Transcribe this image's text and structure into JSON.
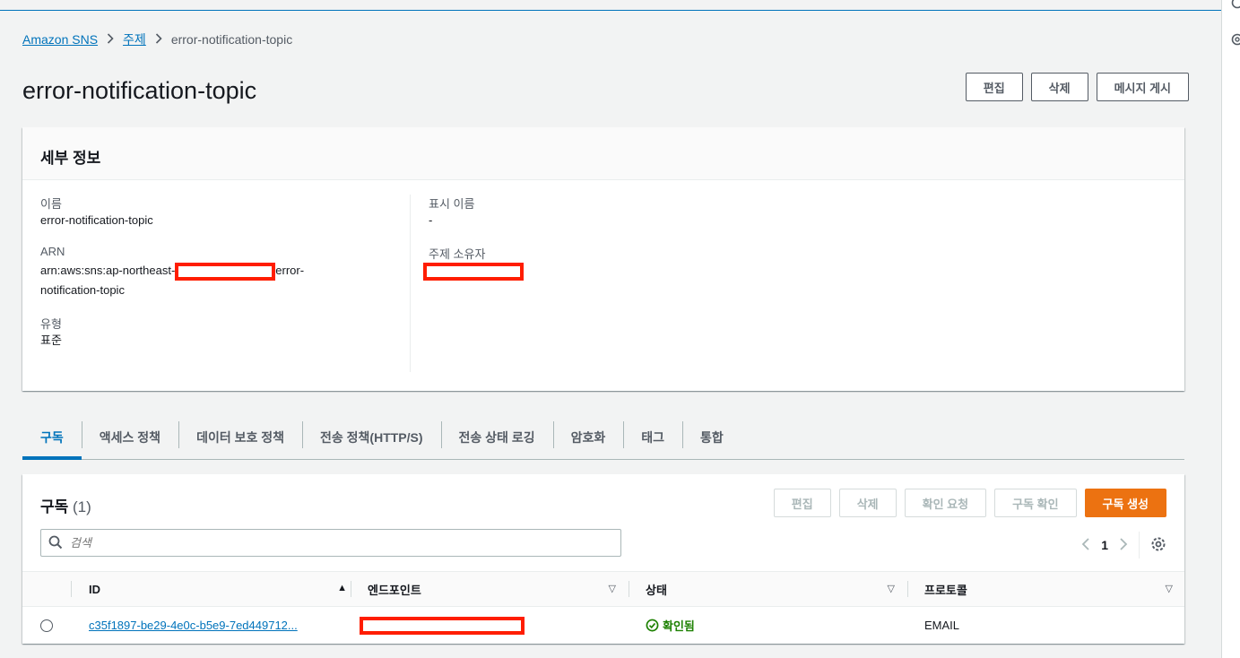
{
  "breadcrumb": {
    "root": "Amazon SNS",
    "section": "주제",
    "current": "error-notification-topic"
  },
  "page": {
    "title": "error-notification-topic"
  },
  "header_buttons": {
    "edit": "편집",
    "delete": "삭제",
    "publish": "메시지 게시"
  },
  "details": {
    "heading": "세부 정보",
    "name_label": "이름",
    "name_value": "error-notification-topic",
    "arn_label": "ARN",
    "arn_prefix": "arn:aws:sns:ap-northeast-",
    "arn_suffix_line1": "error-",
    "arn_suffix_line2": "notification-topic",
    "type_label": "유형",
    "type_value": "표준",
    "display_name_label": "표시 이름",
    "display_name_value": "-",
    "owner_label": "주제 소유자"
  },
  "tabs": [
    {
      "label": "구독",
      "active": true
    },
    {
      "label": "액세스 정책"
    },
    {
      "label": "데이터 보호 정책"
    },
    {
      "label": "전송 정책(HTTP/S)"
    },
    {
      "label": "전송 상태 로깅"
    },
    {
      "label": "암호화"
    },
    {
      "label": "태그"
    },
    {
      "label": "통합"
    }
  ],
  "subscriptions": {
    "title": "구독",
    "count": "(1)",
    "buttons": {
      "edit": "편집",
      "delete": "삭제",
      "request_confirm": "확인 요청",
      "confirm": "구독 확인",
      "create": "구독 생성"
    },
    "search_placeholder": "검색",
    "page": "1",
    "columns": {
      "id": "ID",
      "endpoint": "엔드포인트",
      "status": "상태",
      "protocol": "프로토콜"
    },
    "rows": [
      {
        "id": "c35f1897-be29-4e0c-b5e9-7ed449712...",
        "status": "확인됨",
        "protocol": "EMAIL"
      }
    ]
  },
  "colors": {
    "accent": "#0073bb",
    "primary_button": "#ec7211",
    "redaction": "#ff1d00",
    "success": "#1d8102"
  }
}
